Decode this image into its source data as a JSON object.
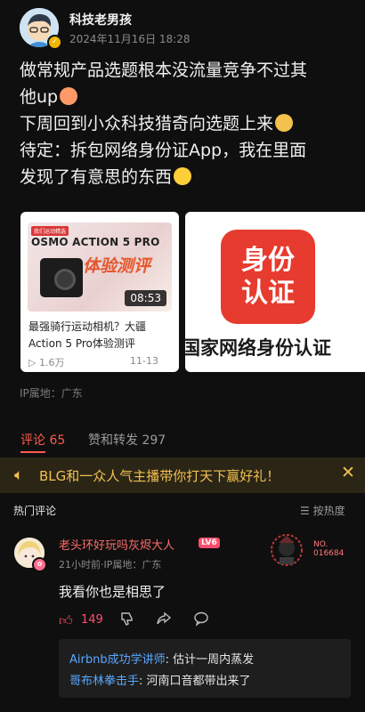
{
  "author": {
    "name": "科技老男孩",
    "time": "2024年11月16日 18:28"
  },
  "post": {
    "lines": [
      "做常规产品选题根本没流量竞争不过其",
      "他up",
      "下周回到小众科技猎奇向选题上来",
      "待定：拆包网络身份证App，我在里面",
      "发现了有意思的东西"
    ]
  },
  "card_video": {
    "badge": "我们运动精选",
    "brand": "OSMO ACTION 5 PRO",
    "overlay": "体验测评",
    "duration": "08:53",
    "title": "最强骑行运动相机？大疆Action 5 Pro体验测评",
    "views": "1.6万",
    "date": "11-13"
  },
  "card_app": {
    "logo_text": "身份认证",
    "caption": "国家网络身份认证"
  },
  "ip_location": "IP属地：广东",
  "tabs": [
    {
      "label": "评论 65"
    },
    {
      "label": "赞和转发 297"
    }
  ],
  "banner": {
    "text": "BLG和一众人气主播带你打天下赢好礼！",
    "close": "✕"
  },
  "comments_header": {
    "title": "热门评论",
    "sort": "按热度"
  },
  "comment": {
    "name": "老头环好玩吗灰烬大人",
    "level": "LV6",
    "meta": "21小时前·IP属地：广东",
    "no_label": "NO.",
    "no_value": "016684",
    "text": "我看你也是相思了",
    "likes": "149",
    "replies": [
      {
        "name": "Airbnb成功学讲师",
        "text": ": 估计一周内蒸发"
      },
      {
        "name": "哥布林拳击手",
        "text": ": 河南口音都带出来了"
      }
    ]
  },
  "colors": {
    "accent": "#ff5a4f",
    "banner_text": "#f2c14e",
    "reply_name": "#5aa8ff"
  }
}
